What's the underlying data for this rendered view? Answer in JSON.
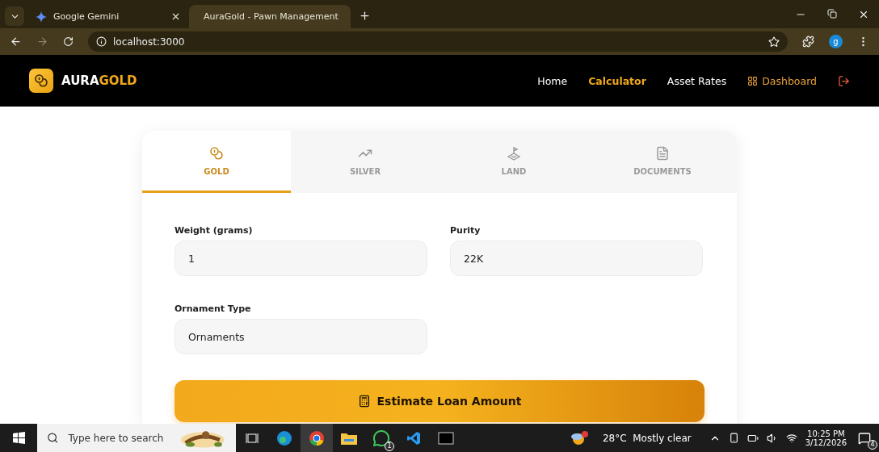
{
  "browser": {
    "tabs": [
      {
        "title": "Google Gemini",
        "selected": false,
        "kind": "gemini"
      },
      {
        "title": "AuraGold - Pawn Management",
        "selected": true,
        "kind": "globe"
      }
    ],
    "url": "localhost:3000",
    "profile": "g"
  },
  "app": {
    "logo": {
      "part1": "AURA",
      "part2": "GOLD"
    },
    "nav": [
      {
        "label": "Home",
        "selected": false,
        "kind": "link"
      },
      {
        "label": "Calculator",
        "selected": true,
        "kind": "link"
      },
      {
        "label": "Asset Rates",
        "selected": false,
        "kind": "link"
      },
      {
        "label": "Dashboard",
        "selected": false,
        "kind": "dashboard"
      }
    ]
  },
  "calculator": {
    "tabs": [
      {
        "label": "GOLD",
        "selected": true,
        "kind": "coins"
      },
      {
        "label": "SILVER",
        "selected": false,
        "kind": "trend"
      },
      {
        "label": "LAND",
        "selected": false,
        "kind": "land"
      },
      {
        "label": "DOCUMENTS",
        "selected": false,
        "kind": "document"
      }
    ],
    "fields": [
      {
        "label": "Weight (grams)",
        "value": "1"
      },
      {
        "label": "Purity",
        "value": "22K"
      },
      {
        "label": "Ornament Type",
        "value": "Ornaments"
      }
    ],
    "button": "Estimate Loan Amount"
  },
  "taskbar": {
    "search_placeholder": "Type here to search",
    "whatsapp_badge": "1",
    "weather": "28°C  Mostly clear",
    "time": "10:25 PM",
    "date": "3/12/2026",
    "notifications": "4"
  }
}
